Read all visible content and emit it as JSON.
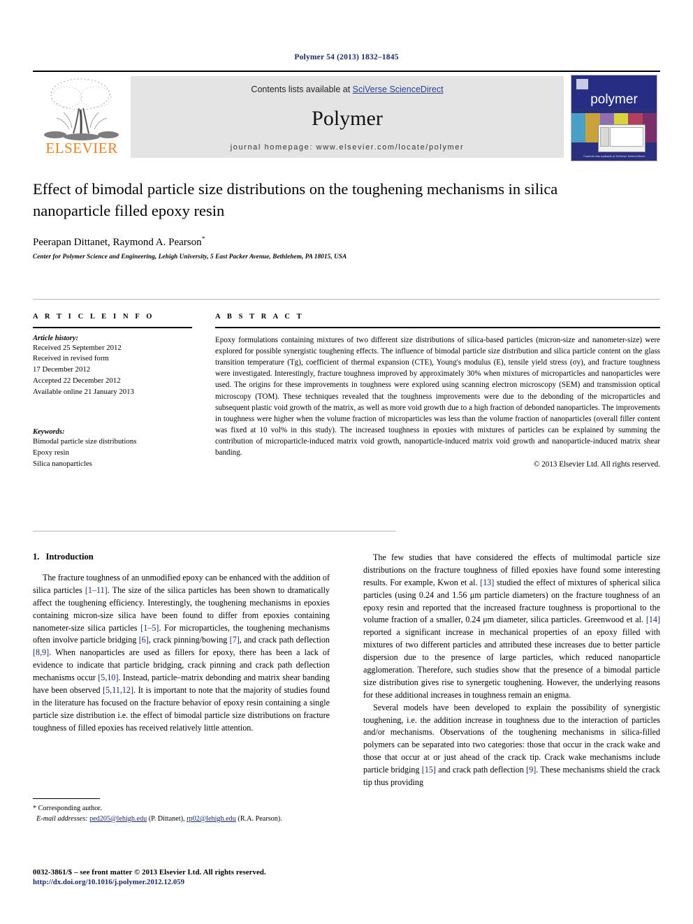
{
  "running_head": "Polymer 54 (2013) 1832–1845",
  "masthead": {
    "publisher_name": "ELSEVIER",
    "contents_prefix": "Contents lists available at ",
    "contents_link": "SciVerse ScienceDirect",
    "journal_title": "Polymer",
    "homepage": "journal homepage: www.elsevier.com/locate/polymer",
    "cover_word": "polymer",
    "cover_footer": "Contents lists available at\nSciVerse ScienceDirect"
  },
  "article": {
    "title": "Effect of bimodal particle size distributions on the toughening mechanisms in silica nanoparticle filled epoxy resin",
    "authors": "Peerapan Dittanet, Raymond A. Pearson",
    "corresponding_marker": "*",
    "affiliation": "Center for Polymer Science and Engineering, Lehigh University, 5 East Packer Avenue, Bethlehem, PA 18015, USA"
  },
  "article_info": {
    "label": "A R T I C L E  I N F O",
    "history_label": "Article history:",
    "history": [
      "Received 25 September 2012",
      "Received in revised form",
      "17 December 2012",
      "Accepted 22 December 2012",
      "Available online 21 January 2013"
    ],
    "keywords_label": "Keywords:",
    "keywords": [
      "Bimodal particle size distributions",
      "Epoxy resin",
      "Silica nanoparticles"
    ]
  },
  "abstract": {
    "label": "A B S T R A C T",
    "text": "Epoxy formulations containing mixtures of two different size distributions of silica-based particles (micron-size and nanometer-size) were explored for possible synergistic toughening effects. The influence of bimodal particle size distribution and silica particle content on the glass transition temperature (Tg), coefficient of thermal expansion (CTE), Young's modulus (E), tensile yield stress (σy), and fracture toughness were investigated. Interestingly, fracture toughness improved by approximately 30% when mixtures of microparticles and nanoparticles were used. The origins for these improvements in toughness were explored using scanning electron microscopy (SEM) and transmission optical microscopy (TOM). These techniques revealed that the toughness improvements were due to the debonding of the microparticles and subsequent plastic void growth of the matrix, as well as more void growth due to a high fraction of debonded nanoparticles. The improvements in toughness were higher when the volume fraction of microparticles was less than the volume fraction of nanoparticles (overall filler content was fixed at 10 vol% in this study). The increased toughness in epoxies with mixtures of particles can be explained by summing the contribution of microparticle-induced matrix void growth, nanoparticle-induced matrix void growth and nanoparticle-induced matrix shear banding.",
    "copyright": "© 2013 Elsevier Ltd. All rights reserved."
  },
  "introduction": {
    "number": "1.",
    "heading": "Introduction",
    "left_paragraphs": [
      "The fracture toughness of an unmodified epoxy can be enhanced with the addition of silica particles [1–11]. The size of the silica particles has been shown to dramatically affect the toughening efficiency. Interestingly, the toughening mechanisms in epoxies containing micron-size silica have been found to differ from epoxies containing nanometer-size silica particles [1–5]. For microparticles, the toughening mechanisms often involve particle bridging [6], crack pinning/bowing [7], and crack path deflection [8,9]. When nanoparticles are used as fillers for epoxy, there has been a lack of evidence to indicate that particle bridging, crack pinning and crack path deflection mechanisms occur [5,10]. Instead, particle–matrix debonding and matrix shear banding have been observed [5,11,12]. It is important to note that the majority of studies found in the literature has focused on the fracture behavior of epoxy resin containing a single particle size distribution i.e. the effect of bimodal particle size distributions on fracture toughness of filled epoxies has received relatively little attention."
    ],
    "right_paragraphs": [
      "The few studies that have considered the effects of multimodal particle size distributions on the fracture toughness of filled epoxies have found some interesting results. For example, Kwon et al. [13] studied the effect of mixtures of spherical silica particles (using 0.24 and 1.56 μm particle diameters) on the fracture toughness of an epoxy resin and reported that the increased fracture toughness is proportional to the volume fraction of a smaller, 0.24 μm diameter, silica particles. Greenwood et al. [14] reported a significant increase in mechanical properties of an epoxy filled with mixtures of two different particles and attributed these increases due to better particle dispersion due to the presence of large particles, which reduced nanoparticle agglomeration. Therefore, such studies show that the presence of a bimodal particle size distribution gives rise to synergetic toughening. However, the underlying reasons for these additional increases in toughness remain an enigma.",
      "Several models have been developed to explain the possibility of synergistic toughening, i.e. the addition increase in toughness due to the interaction of particles and/or mechanisms. Observations of the toughening mechanisms in silica-filled polymers can be separated into two categories: those that occur in the crack wake and those that occur at or just ahead of the crack tip. Crack wake mechanisms include particle bridging [15] and crack path deflection [9]. These mechanisms shield the crack tip thus providing"
    ]
  },
  "footnote": {
    "corresponding": "* Corresponding author.",
    "email_label": "E-mail addresses:",
    "email1": "ped205@lehigh.edu",
    "email1_owner": "(P. Dittanet),",
    "email2": "rp02@lehigh.edu",
    "email2_owner": "(R.A. Pearson)."
  },
  "bottom": {
    "issn_line": "0032-3861/$ – see front matter © 2013 Elsevier Ltd. All rights reserved.",
    "doi_line": "http://dx.doi.org/10.1016/j.polymer.2012.12.059"
  },
  "colors": {
    "link_blue": "#1b2a6b",
    "elsevier_orange": "#f08020",
    "banner_gray": "#e4e4e4",
    "cover_blue": "#262d82"
  }
}
